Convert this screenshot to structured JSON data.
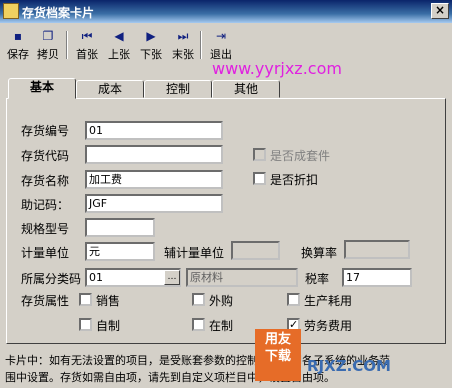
{
  "window": {
    "title": "存货档案卡片",
    "close_glyph": "×"
  },
  "toolbar": {
    "buttons": [
      {
        "label": "保存",
        "icon": "floppy-icon",
        "glyph": "▪"
      },
      {
        "label": "拷贝",
        "icon": "copy-icon",
        "glyph": "❐"
      },
      {
        "label": "首张",
        "icon": "first-record-icon",
        "glyph": "⏮"
      },
      {
        "label": "上张",
        "icon": "previous-record-icon",
        "glyph": "◀"
      },
      {
        "label": "下张",
        "icon": "next-record-icon",
        "glyph": "▶"
      },
      {
        "label": "末张",
        "icon": "last-record-icon",
        "glyph": "⏭"
      },
      {
        "label": "退出",
        "icon": "exit-icon",
        "glyph": "⇥"
      }
    ]
  },
  "watermark": "www.yyrjxz.com",
  "tabs": [
    "基本",
    "成本",
    "控制",
    "其他"
  ],
  "form": {
    "code_label": "存货编号",
    "code_value": "01",
    "alias_label": "存货代码",
    "alias_value": "",
    "set_label": "是否成套件",
    "name_label": "存货名称",
    "name_value": "加工费",
    "discount_label": "是否折扣",
    "mnemonic_label": "助记码：",
    "mnemonic_value": "JGF",
    "spec_label": "规格型号",
    "spec_value": "",
    "unit_label": "计量单位",
    "unit_value": "元",
    "aux_unit_label": "辅计量单位",
    "aux_unit_value": "",
    "rate_label": "换算率",
    "rate_value": "",
    "category_label": "所属分类码",
    "category_code": "01",
    "category_name": "原材料",
    "ref_glyph": "…",
    "tax_label": "税率",
    "tax_value": "17",
    "attr_label": "存货属性",
    "attrs": [
      {
        "label": "销售",
        "checked": false
      },
      {
        "label": "外购",
        "checked": false
      },
      {
        "label": "生产耗用",
        "checked": false
      },
      {
        "label": "自制",
        "checked": false
      },
      {
        "label": "在制",
        "checked": false
      },
      {
        "label": "劳务费用",
        "checked": true
      }
    ]
  },
  "note": {
    "line1": "卡片中：如有无法设置的项目，是受账套参数的控制，请先到各子系统的业务范",
    "line2": "围中设置。存货如需自由项，请先到自定义项栏目中，设置自由项。"
  },
  "logo": {
    "line1": "用友",
    "line2": "下载",
    "side": "RJXZ.COM"
  },
  "colors": {
    "title_start": "#0a246a",
    "title_end": "#a6caf0",
    "watermark": "#e020e0",
    "logo_bg": "#e66c28",
    "face": "#d4d0c8"
  }
}
